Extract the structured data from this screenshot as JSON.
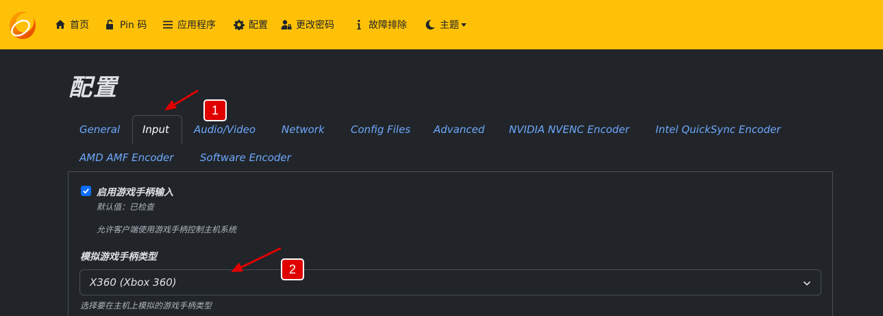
{
  "nav": {
    "items": [
      {
        "label": "首页",
        "icon": "home-icon"
      },
      {
        "label": "Pin 码",
        "icon": "lock-open-icon"
      },
      {
        "label": "应用程序",
        "icon": "list-icon"
      },
      {
        "label": "配置",
        "icon": "gear-icon"
      },
      {
        "label": "更改密码",
        "icon": "user-lock-icon"
      },
      {
        "label": "故障排除",
        "icon": "info-icon"
      },
      {
        "label": "主题",
        "icon": "moon-icon"
      }
    ]
  },
  "page": {
    "title": "配置"
  },
  "tabs": [
    {
      "label": "General"
    },
    {
      "label": "Input"
    },
    {
      "label": "Audio/Video"
    },
    {
      "label": "Network"
    },
    {
      "label": "Config Files"
    },
    {
      "label": "Advanced"
    },
    {
      "label": "NVIDIA NVENC Encoder"
    },
    {
      "label": "Intel QuickSync Encoder"
    },
    {
      "label": "AMD AMF Encoder"
    },
    {
      "label": "Software Encoder"
    }
  ],
  "active_tab": "Input",
  "settings": {
    "gamepad_enable": {
      "label": "启用游戏手柄输入",
      "checked": true,
      "default_text": "默认值：已检查",
      "description": "允许客户端使用游戏手柄控制主机系统"
    },
    "gamepad_type": {
      "label": "模拟游戏手柄类型",
      "value": "X360 (Xbox 360)",
      "help": "选择要在主机上模拟的游戏手柄类型"
    }
  },
  "annotations": {
    "badge1": "1",
    "badge2": "2",
    "color": "#e00000"
  },
  "colors": {
    "navbar": "#ffc107",
    "background": "#212529",
    "link": "#6ea8fe",
    "accent": "#0d6efd"
  }
}
